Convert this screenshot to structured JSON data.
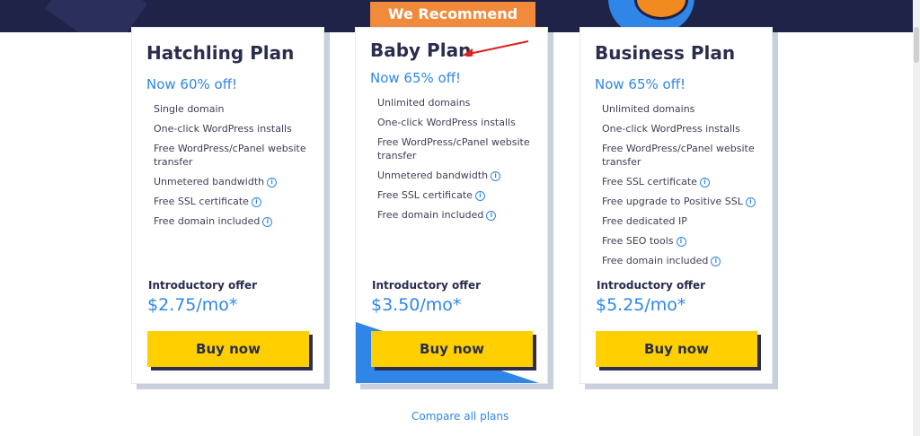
{
  "colors": {
    "navy": "#1f2348",
    "accent_blue": "#2f86e6",
    "orange": "#f18a3a",
    "button_yellow": "#ffcf00",
    "text_dark": "#2a2d4d"
  },
  "recommend_label": "We Recommend",
  "plans": [
    {
      "name": "Hatchling Plan",
      "discount": "Now 60% off!",
      "features": [
        {
          "text": "Single domain",
          "info": false
        },
        {
          "text": "One-click WordPress installs",
          "info": false
        },
        {
          "text": "Free WordPress/cPanel website transfer",
          "info": false
        },
        {
          "text": "Unmetered bandwidth",
          "info": true
        },
        {
          "text": "Free SSL certificate",
          "info": true
        },
        {
          "text": "Free domain included",
          "info": true
        }
      ],
      "intro_label": "Introductory offer",
      "price": "$2.75/mo*",
      "button": "Buy now"
    },
    {
      "name": "Baby Plan",
      "discount": "Now 65% off!",
      "features": [
        {
          "text": "Unlimited domains",
          "info": false
        },
        {
          "text": "One-click WordPress installs",
          "info": false
        },
        {
          "text": "Free WordPress/cPanel website transfer",
          "info": false
        },
        {
          "text": "Unmetered bandwidth",
          "info": true
        },
        {
          "text": "Free SSL certificate",
          "info": true
        },
        {
          "text": "Free domain included",
          "info": true
        }
      ],
      "intro_label": "Introductory offer",
      "price": "$3.50/mo*",
      "button": "Buy now"
    },
    {
      "name": "Business Plan",
      "discount": "Now 65% off!",
      "features": [
        {
          "text": "Unlimited domains",
          "info": false
        },
        {
          "text": "One-click WordPress installs",
          "info": false
        },
        {
          "text": "Free WordPress/cPanel website transfer",
          "info": false
        },
        {
          "text": "Free SSL certificate",
          "info": true
        },
        {
          "text": "Free upgrade to Positive SSL",
          "info": true
        },
        {
          "text": "Free dedicated IP",
          "info": false
        },
        {
          "text": "Free SEO tools",
          "info": true
        },
        {
          "text": "Free domain included",
          "info": true
        }
      ],
      "intro_label": "Introductory offer",
      "price": "$5.25/mo*",
      "button": "Buy now"
    }
  ],
  "compare_link": "Compare all plans"
}
